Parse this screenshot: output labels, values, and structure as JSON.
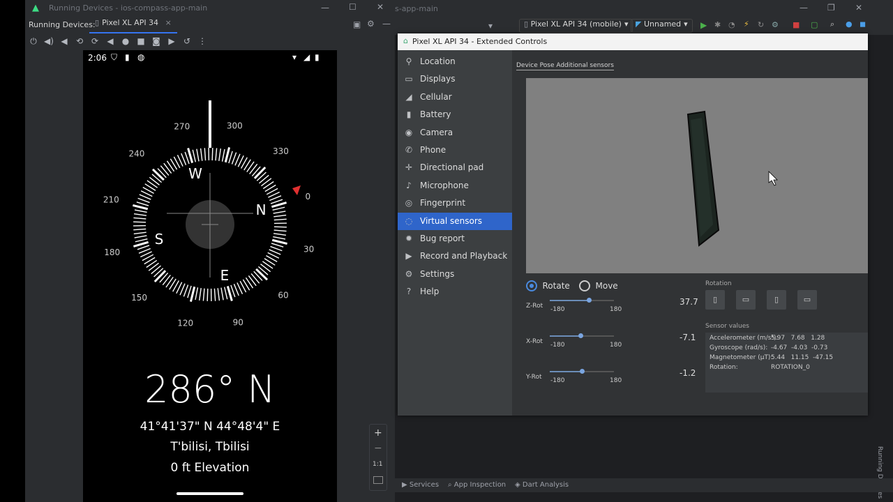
{
  "left_window": {
    "title": "Running Devices - ios-compass-app-main",
    "label": "Running Devices:",
    "tab": "Pixel XL API 34",
    "tab_close": "×"
  },
  "phone": {
    "time": "2:06",
    "dial": {
      "ring_numbers": [
        "0",
        "30",
        "60",
        "90",
        "120",
        "150",
        "180",
        "210",
        "240",
        "270",
        "300",
        "330"
      ],
      "cardinals": {
        "N": "N",
        "E": "E",
        "S": "S",
        "W": "W"
      }
    },
    "heading": "286° N",
    "coords": "41°41'37\" N 44°48'4\" E",
    "city": "T'bilisi, Tbilisi",
    "elevation": "0 ft Elevation"
  },
  "zoom": {
    "plus": "+",
    "minus": "−",
    "one_to_one": "1:1"
  },
  "ide": {
    "title_partial": "s-app-main",
    "device_select": "Pixel XL API 34 (mobile)",
    "config_select": "Unnamed"
  },
  "ext": {
    "title": "Pixel XL API 34 - Extended Controls",
    "nav": [
      {
        "label": "Location",
        "icon": "location-pin-icon"
      },
      {
        "label": "Displays",
        "icon": "display-icon"
      },
      {
        "label": "Cellular",
        "icon": "cellular-icon"
      },
      {
        "label": "Battery",
        "icon": "battery-icon"
      },
      {
        "label": "Camera",
        "icon": "camera-icon"
      },
      {
        "label": "Phone",
        "icon": "phone-icon"
      },
      {
        "label": "Directional pad",
        "icon": "dpad-icon"
      },
      {
        "label": "Microphone",
        "icon": "microphone-icon"
      },
      {
        "label": "Fingerprint",
        "icon": "fingerprint-icon"
      },
      {
        "label": "Virtual sensors",
        "icon": "virtual-sensors-icon",
        "selected": true
      },
      {
        "label": "Bug report",
        "icon": "bug-icon"
      },
      {
        "label": "Record and Playback",
        "icon": "record-icon"
      },
      {
        "label": "Settings",
        "icon": "gear-icon"
      },
      {
        "label": "Help",
        "icon": "help-icon"
      }
    ],
    "subtabs": "Device Pose Additional sensors",
    "mode": {
      "rotate": "Rotate",
      "move": "Move"
    },
    "sliders": [
      {
        "label": "Z-Rot",
        "min": "-180",
        "max": "180",
        "value": "37.7",
        "fraction": 0.604
      },
      {
        "label": "X-Rot",
        "min": "-180",
        "max": "180",
        "value": "-7.1",
        "fraction": 0.48
      },
      {
        "label": "Y-Rot",
        "min": "-180",
        "max": "180",
        "value": "-1.2",
        "fraction": 0.497
      }
    ],
    "rotation_label": "Rotation",
    "sensor_values_label": "Sensor values",
    "sensors": [
      {
        "name": "Accelerometer (m/s²):",
        "value": "5.97   7.68   1.28"
      },
      {
        "name": "Gyroscope (rad/s):",
        "value": "-4.67  -4.03  -0.73"
      },
      {
        "name": "Magnetometer (µT):",
        "value": "5.44   11.15  -47.15"
      },
      {
        "name": "Rotation:",
        "value": "ROTATION_0"
      }
    ]
  },
  "bottom_tabs": {
    "services": "Services",
    "app_inspection": "App Inspection",
    "dart_analysis": "Dart Analysis"
  },
  "side_label": "Running Devices",
  "colors": {
    "accent": "#2f65ca",
    "compass_marker": "#e03030"
  }
}
